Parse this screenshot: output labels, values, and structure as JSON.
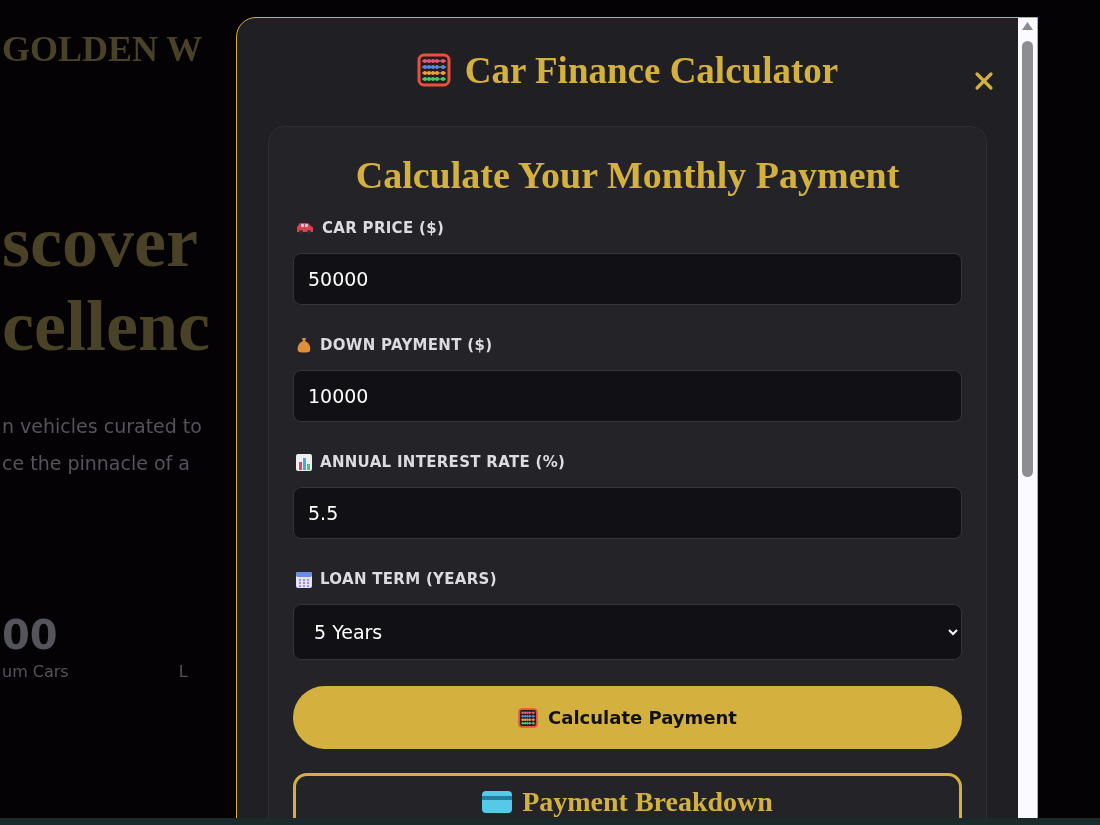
{
  "background": {
    "brand": "GOLDEN W",
    "headline": [
      "scover",
      "cellenc"
    ],
    "tagline": [
      "n vehicles curated to",
      "ce the pinnacle of a"
    ],
    "stats": [
      {
        "value": "00",
        "label": "um Cars"
      },
      {
        "label": "L"
      }
    ]
  },
  "modal": {
    "title": "Car Finance Calculator",
    "card": {
      "heading": "Calculate Your Monthly Payment",
      "fields": [
        {
          "kind": "input",
          "label": "CAR PRICE ($)",
          "value": "50000"
        },
        {
          "kind": "input",
          "label": "DOWN PAYMENT ($)",
          "value": "10000"
        },
        {
          "kind": "input",
          "label": "ANNUAL INTEREST RATE (%)",
          "value": "5.5"
        },
        {
          "kind": "select",
          "label": "LOAN TERM (YEARS)",
          "value": "5 Years"
        }
      ],
      "button": "Calculate Payment",
      "result": {
        "heading": "Payment Breakdown"
      }
    }
  }
}
